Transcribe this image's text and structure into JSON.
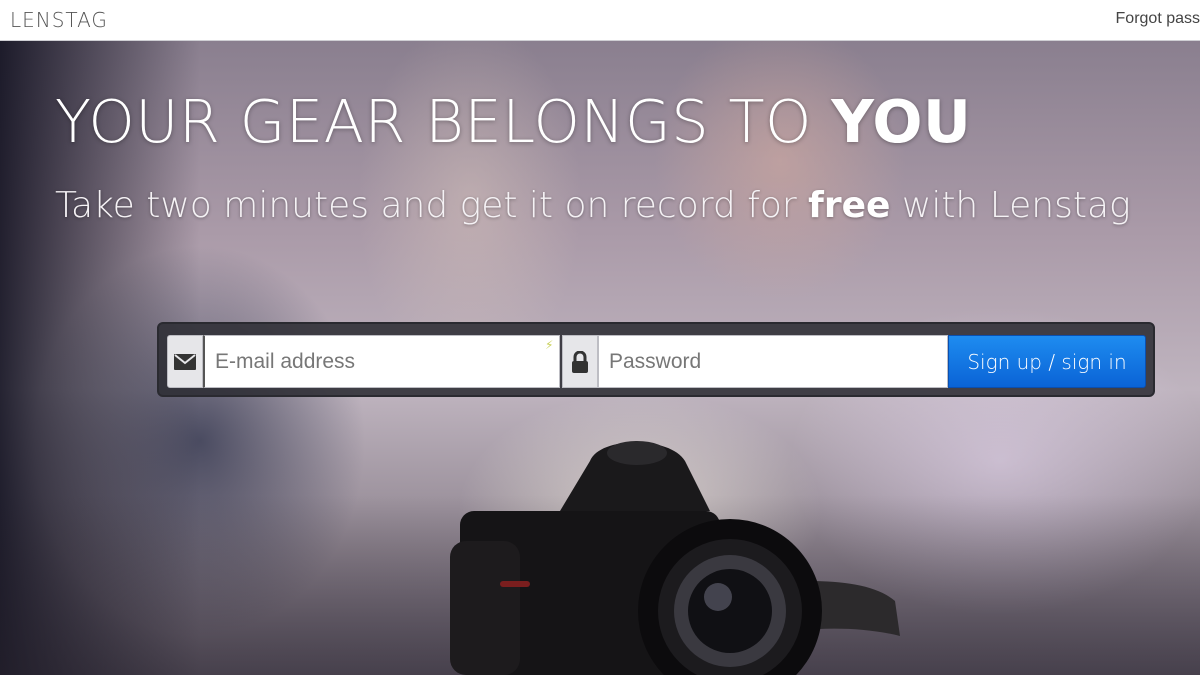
{
  "header": {
    "logo": "LENSTAG",
    "forgot_link": "Forgot pass"
  },
  "hero": {
    "headline_light": "YOUR GEAR BELONGS TO",
    "headline_bold": "YOU",
    "subline_before": "Take two minutes and get it on record for",
    "subline_bold": "free",
    "subline_after": "with Lenstag"
  },
  "signup_form": {
    "email_placeholder": "E-mail address",
    "password_placeholder": "Password",
    "submit_label": "Sign up / sign in",
    "icons": {
      "email": "envelope-icon",
      "password": "lock-icon"
    },
    "accent_color": "#0a63d6"
  }
}
